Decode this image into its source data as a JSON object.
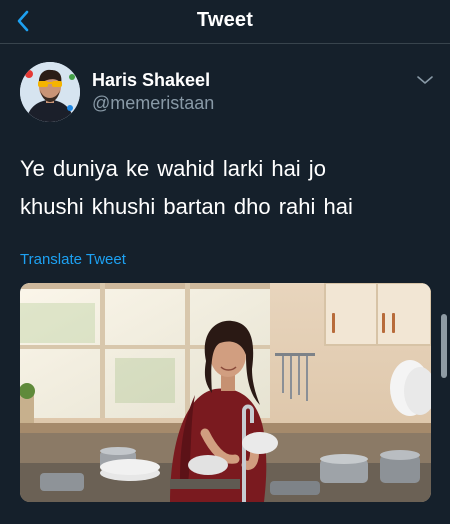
{
  "header": {
    "title": "Tweet",
    "back_icon": "chevron-left-icon",
    "accent_color": "#1da1f2"
  },
  "tweet": {
    "author_name": "Haris Shakeel",
    "author_handle": "@memeristaan",
    "text_line1": "Ye duniya ke wahid larki hai jo",
    "text_line2": "khushi khushi bartan dho rahi hai",
    "translate_label": "Translate Tweet",
    "more_icon": "chevron-down-icon",
    "media": "photo of a smiling woman washing dishes at a kitchen sink"
  },
  "colors": {
    "background": "#15202b",
    "secondary_text": "#8899a6",
    "divider": "#38444d"
  }
}
